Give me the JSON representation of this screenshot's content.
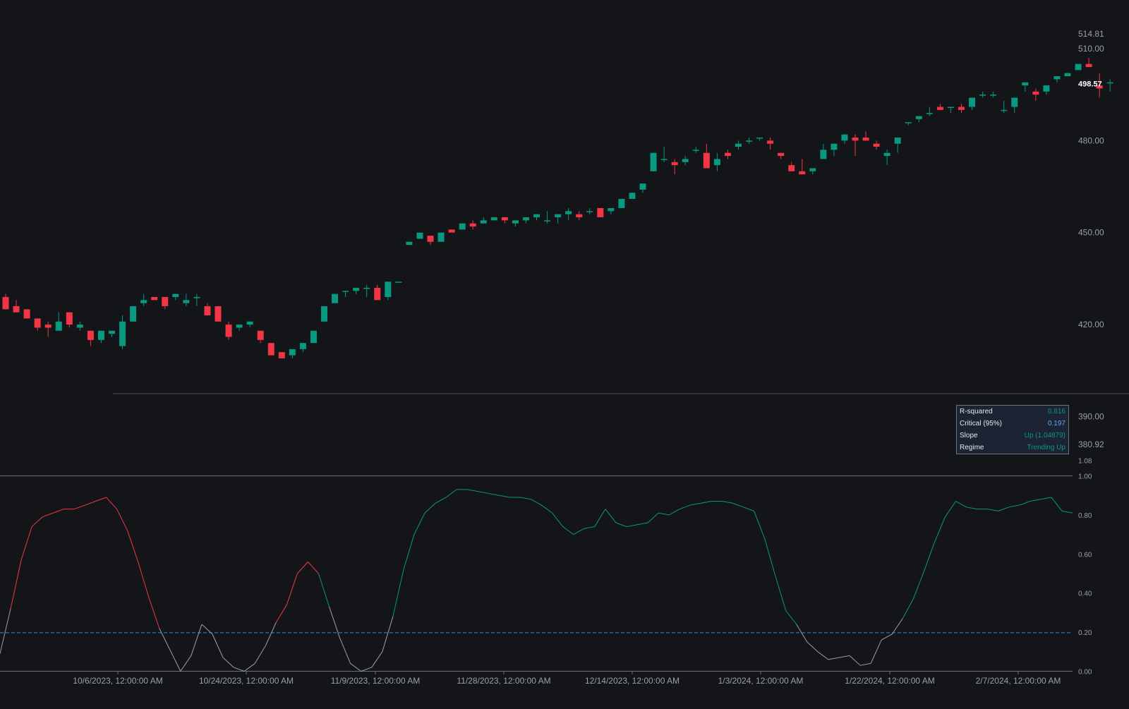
{
  "colors": {
    "background": "#131519",
    "up": "#089981",
    "down": "#f23645",
    "r2_down": "#f23645",
    "r2_up": "#089981",
    "r2_neutral": "#9aa0a8",
    "critical_line": "#3b82f6",
    "axis_text": "#9aa0a8",
    "last_price_text": "#ffffff"
  },
  "price_axis": {
    "ticks": [
      "510.00",
      "480.00",
      "450.00",
      "420.00",
      "390.00"
    ],
    "high_label": "514.81",
    "last_label": "498.57",
    "low_label": "380.92"
  },
  "indicator_axis": {
    "ticks": [
      "1.08",
      "1.00",
      "0.80",
      "0.60",
      "0.40",
      "0.20",
      "0.00"
    ]
  },
  "time_axis": {
    "labels": [
      "10/6/2023, 12:00:00 AM",
      "10/24/2023, 12:00:00 AM",
      "11/9/2023, 12:00:00 AM",
      "11/28/2023, 12:00:00 AM",
      "12/14/2023, 12:00:00 AM",
      "1/3/2024, 12:00:00 AM",
      "1/22/2024, 12:00:00 AM",
      "2/7/2024, 12:00:00 AM"
    ]
  },
  "info_table": {
    "rows": [
      {
        "label": "R-squared",
        "value": "0.816",
        "color": "#089981"
      },
      {
        "label": "Critical (95%)",
        "value": "0.197",
        "color": "#60a5fa"
      },
      {
        "label": "Slope",
        "value": "Up (1.04879)",
        "color": "#089981"
      },
      {
        "label": "Regime",
        "value": "Trending Up",
        "color": "#089981"
      }
    ]
  },
  "chart_data": [
    {
      "type": "candlestick",
      "title": "",
      "ylim": [
        380.92,
        514.81
      ],
      "last_price": 498.57,
      "ohlc": [
        [
          429,
          430,
          425,
          425
        ],
        [
          426,
          428,
          424,
          424
        ],
        [
          425,
          425,
          422,
          422
        ],
        [
          422,
          422,
          418,
          419
        ],
        [
          420,
          421,
          416,
          419
        ],
        [
          418,
          424,
          418,
          421
        ],
        [
          424,
          424,
          419,
          420
        ],
        [
          419,
          421,
          418,
          420
        ],
        [
          418,
          418,
          413,
          415
        ],
        [
          415,
          418,
          414,
          418
        ],
        [
          417,
          418,
          416,
          418
        ],
        [
          413,
          423,
          412,
          421
        ],
        [
          421,
          426,
          421,
          426
        ],
        [
          427,
          430,
          426,
          428
        ],
        [
          429,
          429,
          428,
          428
        ],
        [
          429,
          429,
          425,
          426
        ],
        [
          429,
          430,
          428,
          430
        ],
        [
          427,
          430,
          426,
          428
        ],
        [
          429,
          430,
          426,
          429
        ],
        [
          426,
          427,
          423,
          423
        ],
        [
          426,
          426,
          421,
          421
        ],
        [
          420,
          421,
          415,
          416
        ],
        [
          419,
          420,
          418,
          420
        ],
        [
          420,
          421,
          419,
          421
        ],
        [
          418,
          418,
          414,
          415
        ],
        [
          414,
          414,
          410,
          410
        ],
        [
          411,
          411,
          409,
          409
        ],
        [
          410,
          412,
          409,
          412
        ],
        [
          412,
          414,
          411,
          414
        ],
        [
          414,
          418,
          414,
          418
        ],
        [
          421,
          426,
          421,
          426
        ],
        [
          427,
          430,
          427,
          430
        ],
        [
          431,
          431,
          429,
          431
        ],
        [
          431,
          432,
          430,
          432
        ],
        [
          432,
          433,
          429,
          432
        ],
        [
          432,
          433,
          428,
          428
        ],
        [
          429,
          434,
          428,
          434
        ],
        [
          434,
          434,
          434,
          434
        ],
        [
          446,
          447,
          446,
          447
        ],
        [
          448,
          450,
          448,
          450
        ],
        [
          449,
          449,
          446,
          447
        ],
        [
          447,
          450,
          447,
          450
        ],
        [
          451,
          451,
          450,
          450
        ],
        [
          451,
          453,
          451,
          453
        ],
        [
          453,
          454,
          451,
          452
        ],
        [
          453,
          455,
          453,
          454
        ],
        [
          454,
          455,
          454,
          455
        ],
        [
          455,
          455,
          453,
          454
        ],
        [
          453,
          453,
          452,
          454
        ],
        [
          454,
          455,
          453,
          455
        ],
        [
          455,
          456,
          454,
          456
        ],
        [
          454,
          457,
          453,
          454
        ],
        [
          455,
          456,
          453,
          456
        ],
        [
          456,
          458,
          454,
          457
        ],
        [
          456,
          457,
          454,
          455
        ],
        [
          457,
          458,
          456,
          457
        ],
        [
          458,
          458,
          455,
          455
        ],
        [
          457,
          458,
          456,
          458
        ],
        [
          458,
          461,
          458,
          461
        ],
        [
          461,
          463,
          461,
          463
        ],
        [
          464,
          466,
          463,
          466
        ],
        [
          470,
          476,
          470,
          476
        ],
        [
          474,
          478,
          473,
          474
        ],
        [
          473,
          474,
          469,
          472
        ],
        [
          473,
          475,
          472,
          474
        ],
        [
          477,
          478,
          476,
          477
        ],
        [
          476,
          479,
          474,
          471
        ],
        [
          472,
          476,
          470,
          474
        ],
        [
          476,
          477,
          474,
          475
        ],
        [
          478,
          480,
          477,
          479
        ],
        [
          480,
          481,
          479,
          480
        ],
        [
          481,
          481,
          480,
          481
        ],
        [
          480,
          481,
          477,
          479
        ],
        [
          476,
          476,
          474,
          475
        ],
        [
          472,
          473,
          470,
          470
        ],
        [
          470,
          474,
          469,
          469
        ],
        [
          470,
          471,
          469,
          471
        ],
        [
          474,
          479,
          474,
          477
        ],
        [
          477,
          479,
          475,
          479
        ],
        [
          480,
          481,
          479,
          482
        ],
        [
          481,
          482,
          475,
          480
        ],
        [
          481,
          483,
          480,
          480
        ],
        [
          479,
          480,
          477,
          478
        ],
        [
          475,
          477,
          472,
          476
        ],
        [
          479,
          481,
          476,
          481
        ],
        [
          486,
          486,
          485,
          486
        ],
        [
          487,
          488,
          486,
          488
        ],
        [
          489,
          491,
          488,
          489
        ],
        [
          491,
          492,
          490,
          490
        ],
        [
          491,
          491,
          489,
          491
        ],
        [
          491,
          492,
          489,
          490
        ],
        [
          491,
          494,
          490,
          494
        ],
        [
          495,
          496,
          494,
          495
        ],
        [
          495,
          496,
          494,
          495
        ],
        [
          490,
          493,
          489,
          490
        ],
        [
          491,
          493,
          489,
          494
        ],
        [
          498,
          499,
          496,
          499
        ],
        [
          496,
          497,
          493,
          495
        ],
        [
          496,
          497,
          495,
          498
        ],
        [
          500,
          501,
          499,
          501
        ],
        [
          501,
          502,
          501,
          502
        ],
        [
          503,
          505,
          503,
          505
        ],
        [
          505,
          507,
          504,
          504
        ],
        [
          498,
          502,
          494,
          497
        ],
        [
          499,
          500,
          496,
          499
        ]
      ]
    },
    {
      "type": "line",
      "title": "",
      "ylim": [
        0,
        1.08
      ],
      "critical": 0.197,
      "values": [
        0.09,
        0.32,
        0.57,
        0.74,
        0.79,
        0.81,
        0.83,
        0.83,
        0.85,
        0.87,
        0.89,
        0.83,
        0.72,
        0.56,
        0.38,
        0.22,
        0.11,
        0.0,
        0.08,
        0.24,
        0.19,
        0.07,
        0.02,
        0.0,
        0.04,
        0.13,
        0.25,
        0.34,
        0.5,
        0.56,
        0.5,
        0.33,
        0.17,
        0.04,
        0.0,
        0.02,
        0.1,
        0.28,
        0.52,
        0.7,
        0.81,
        0.86,
        0.89,
        0.93,
        0.93,
        0.92,
        0.91,
        0.9,
        0.89,
        0.89,
        0.88,
        0.85,
        0.81,
        0.74,
        0.7,
        0.73,
        0.74,
        0.83,
        0.76,
        0.74,
        0.75,
        0.76,
        0.81,
        0.8,
        0.83,
        0.85,
        0.86,
        0.87,
        0.87,
        0.86,
        0.84,
        0.82,
        0.68,
        0.49,
        0.31,
        0.24,
        0.15,
        0.1,
        0.06,
        0.07,
        0.08,
        0.03,
        0.04,
        0.16,
        0.19,
        0.27,
        0.37,
        0.51,
        0.66,
        0.79,
        0.87,
        0.84,
        0.83,
        0.83,
        0.82,
        0.84,
        0.85,
        0.87,
        0.88,
        0.89,
        0.82,
        0.81
      ]
    }
  ]
}
